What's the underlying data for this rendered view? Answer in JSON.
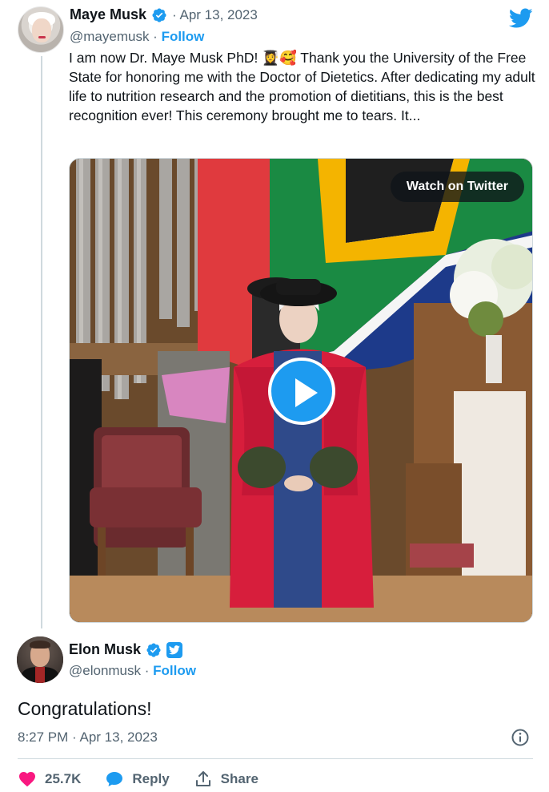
{
  "quoted_tweet": {
    "name": "Maye Musk",
    "date": "· Apr 13, 2023",
    "handle": "@mayemusk",
    "separator": " · ",
    "follow_label": "Follow",
    "text": "I am now Dr. Maye Musk PhD! 👩‍🎓🥰 Thank you the University of the Free State for honoring me with the Doctor of Dietetics. After dedicating my adult life to nutrition research and the promotion of dietitians, this is the best recognition ever! This ceremony brought me to tears. It...",
    "media": {
      "watch_label": "Watch on Twitter",
      "play_icon": "play-icon"
    }
  },
  "main_tweet": {
    "name": "Elon Musk",
    "handle": "@elonmusk",
    "separator": " · ",
    "follow_label": "Follow",
    "text": "Congratulations!",
    "timestamp": "8:27 PM · Apr 13, 2023"
  },
  "actions": {
    "like_count": "25.7K",
    "reply_label": "Reply",
    "share_label": "Share"
  },
  "colors": {
    "accent": "#1d9bf0",
    "like": "#f91880",
    "secondary_text": "#536471"
  },
  "icons": [
    "verified-badge-icon",
    "twitter-bird-icon",
    "twitter-badge-icon",
    "info-icon",
    "heart-icon",
    "reply-icon",
    "share-icon",
    "play-icon"
  ]
}
